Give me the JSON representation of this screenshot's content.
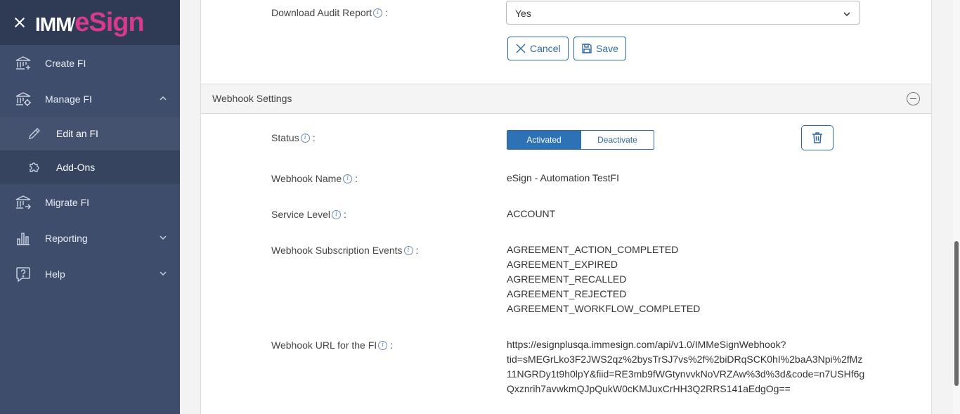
{
  "brand": {
    "imm": "IMM",
    "esign": "eSign"
  },
  "sidebar": {
    "items": [
      {
        "label": "Create FI"
      },
      {
        "label": "Manage FI"
      },
      {
        "label": "Edit an FI"
      },
      {
        "label": "Add-Ons"
      },
      {
        "label": "Migrate FI"
      },
      {
        "label": "Reporting"
      },
      {
        "label": "Help"
      }
    ]
  },
  "audit": {
    "label": "Download Audit Report",
    "colon": ":",
    "selected": "Yes"
  },
  "actions": {
    "cancel": "Cancel",
    "save": "Save"
  },
  "webhook": {
    "section_title": "Webhook Settings",
    "status_label": "Status",
    "activated": "Activated",
    "deactivate": "Deactivate",
    "name_label": "Webhook Name",
    "name_value": "eSign - Automation TestFI",
    "service_label": "Service Level",
    "service_value": "ACCOUNT",
    "events_label": "Webhook Subscription Events",
    "events": [
      "AGREEMENT_ACTION_COMPLETED",
      "AGREEMENT_EXPIRED",
      "AGREEMENT_RECALLED",
      "AGREEMENT_REJECTED",
      "AGREEMENT_WORKFLOW_COMPLETED"
    ],
    "url_label": "Webhook URL for the FI",
    "url_lines": [
      "https://esignplusqa.immesign.com/api/v1.0/IMMeSignWebhook?",
      "tid=sMEGrLko3F2JWS2qz%2bysTrSJ7vs%2f%2biDRqSCK0hI%2baA3Npi%2fMz",
      "11NGRDy1t9h0lpY&fiid=RE3mb9fWGtynvvkNoVRZAw%3d%3d&code=n7USHf6g",
      "Qxznrih7avwkmQJpQukW0cKMJuxCrHH3Q2RRS141aEdgOg=="
    ]
  },
  "colors": {
    "sidebar": "#3e4d6c",
    "accent": "#2e72b6",
    "brand_pink": "#d63a8e"
  }
}
